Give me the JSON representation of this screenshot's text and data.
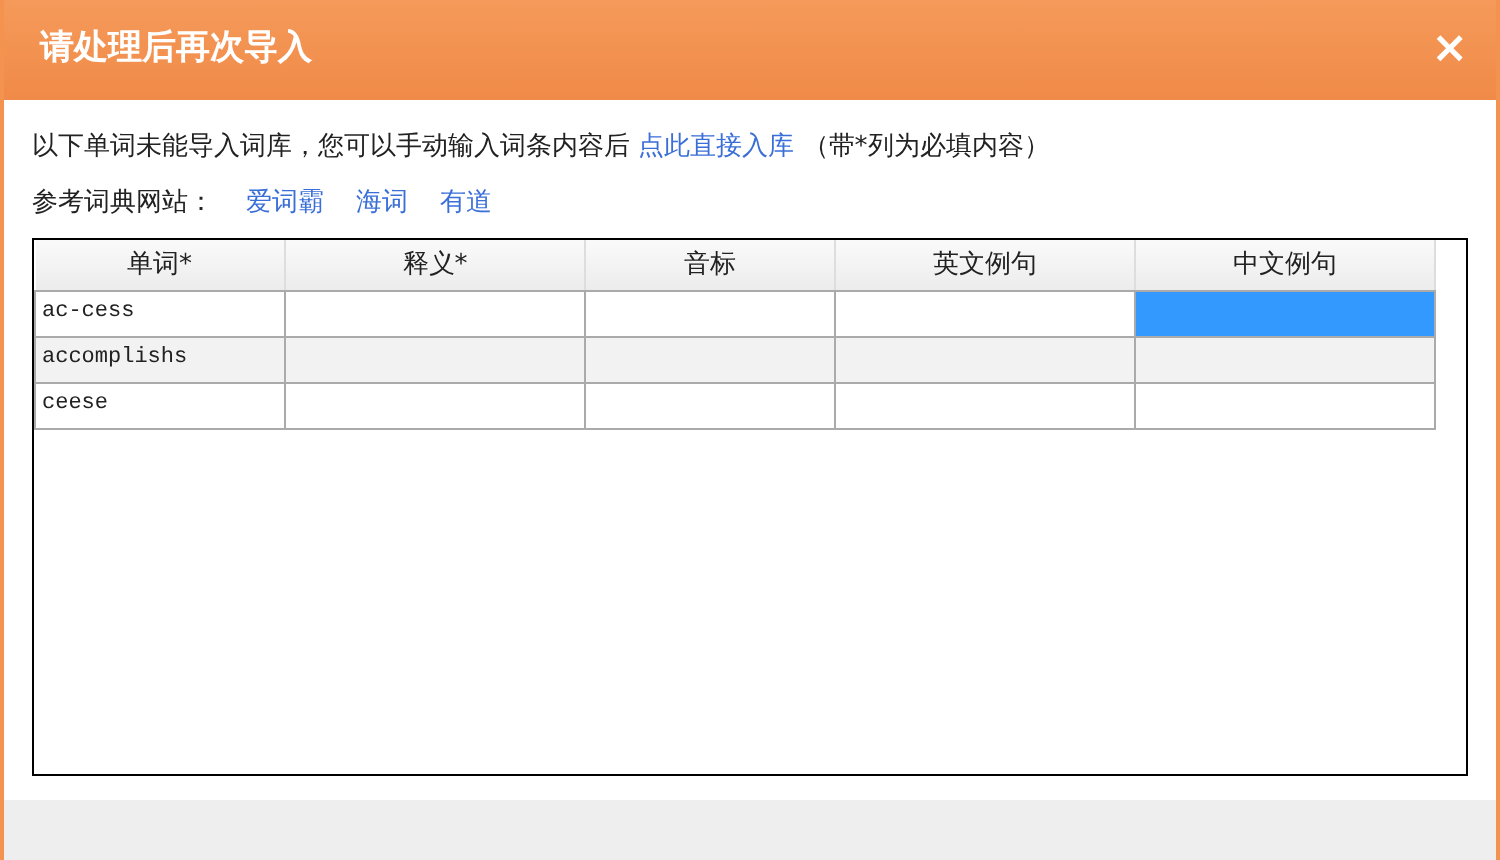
{
  "dialog": {
    "title": "请处理后再次导入",
    "close": "×"
  },
  "message": {
    "text": "以下单词未能导入词库，您可以手动输入词条内容后",
    "link": "点此直接入库",
    "note": "（带*列为必填内容）"
  },
  "references": {
    "label": "参考词典网站：",
    "links": [
      "爱词霸",
      "海词",
      "有道"
    ]
  },
  "table": {
    "columns": [
      "单词*",
      "释义*",
      "音标",
      "英文例句",
      "中文例句"
    ],
    "rows": [
      {
        "word": "ac-cess",
        "cells": [
          {
            "selected": false
          },
          {
            "selected": false
          },
          {
            "selected": false
          },
          {
            "selected": true
          }
        ]
      },
      {
        "word": "accomplishs",
        "cells": [
          {
            "selected": false
          },
          {
            "selected": false
          },
          {
            "selected": false
          },
          {
            "selected": false
          }
        ]
      },
      {
        "word": "ceese",
        "cells": [
          {
            "selected": false
          },
          {
            "selected": false
          },
          {
            "selected": false
          },
          {
            "selected": false
          }
        ]
      }
    ]
  }
}
